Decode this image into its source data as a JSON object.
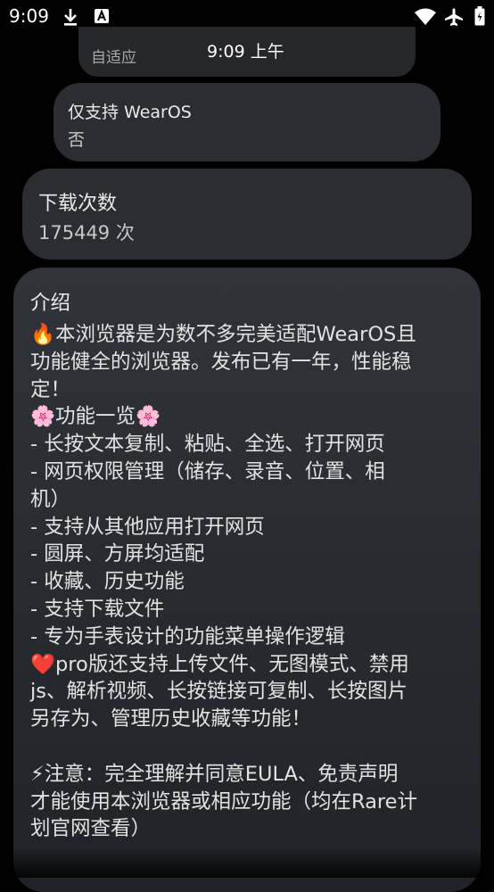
{
  "status_bar": {
    "time": "9:09",
    "icons": [
      "download-icon",
      "text-a-icon",
      "wifi-icon",
      "airplane-icon",
      "battery-icon"
    ]
  },
  "top_card": {
    "label": "自适应",
    "time_overlay": "9:09 上午"
  },
  "wearos_card": {
    "title": "仅支持 WearOS",
    "value": "否"
  },
  "downloads_card": {
    "title": "下载次数",
    "value": "175449 次"
  },
  "intro_card": {
    "title": "介绍",
    "lines": [
      "🔥本浏览器是为数不多完美适配WearOS且",
      "功能健全的浏览器。发布已有一年，性能稳",
      "定！",
      "🌸功能一览🌸",
      "- 长按文本复制、粘贴、全选、打开网页",
      "- 网页权限管理（储存、录音、位置、相",
      "机）",
      "- 支持从其他应用打开网页",
      "- 圆屏、方屏均适配",
      "- 收藏、历史功能",
      "- 支持下载文件",
      "- 专为手表设计的功能菜单操作逻辑",
      "❤️pro版还支持上传文件、无图模式、禁用",
      "js、解析视频、长按链接可复制、长按图片",
      "另存为、管理历史收藏等功能！",
      "",
      "⚡注意：完全理解并同意EULA、免责声明",
      "才能使用本浏览器或相应功能（均在Rare计",
      "划官网查看）"
    ]
  },
  "colors": {
    "background": "#000000",
    "card": "#2a2d32",
    "text_primary": "#eaeaea",
    "text_secondary": "#c8c8c8"
  }
}
